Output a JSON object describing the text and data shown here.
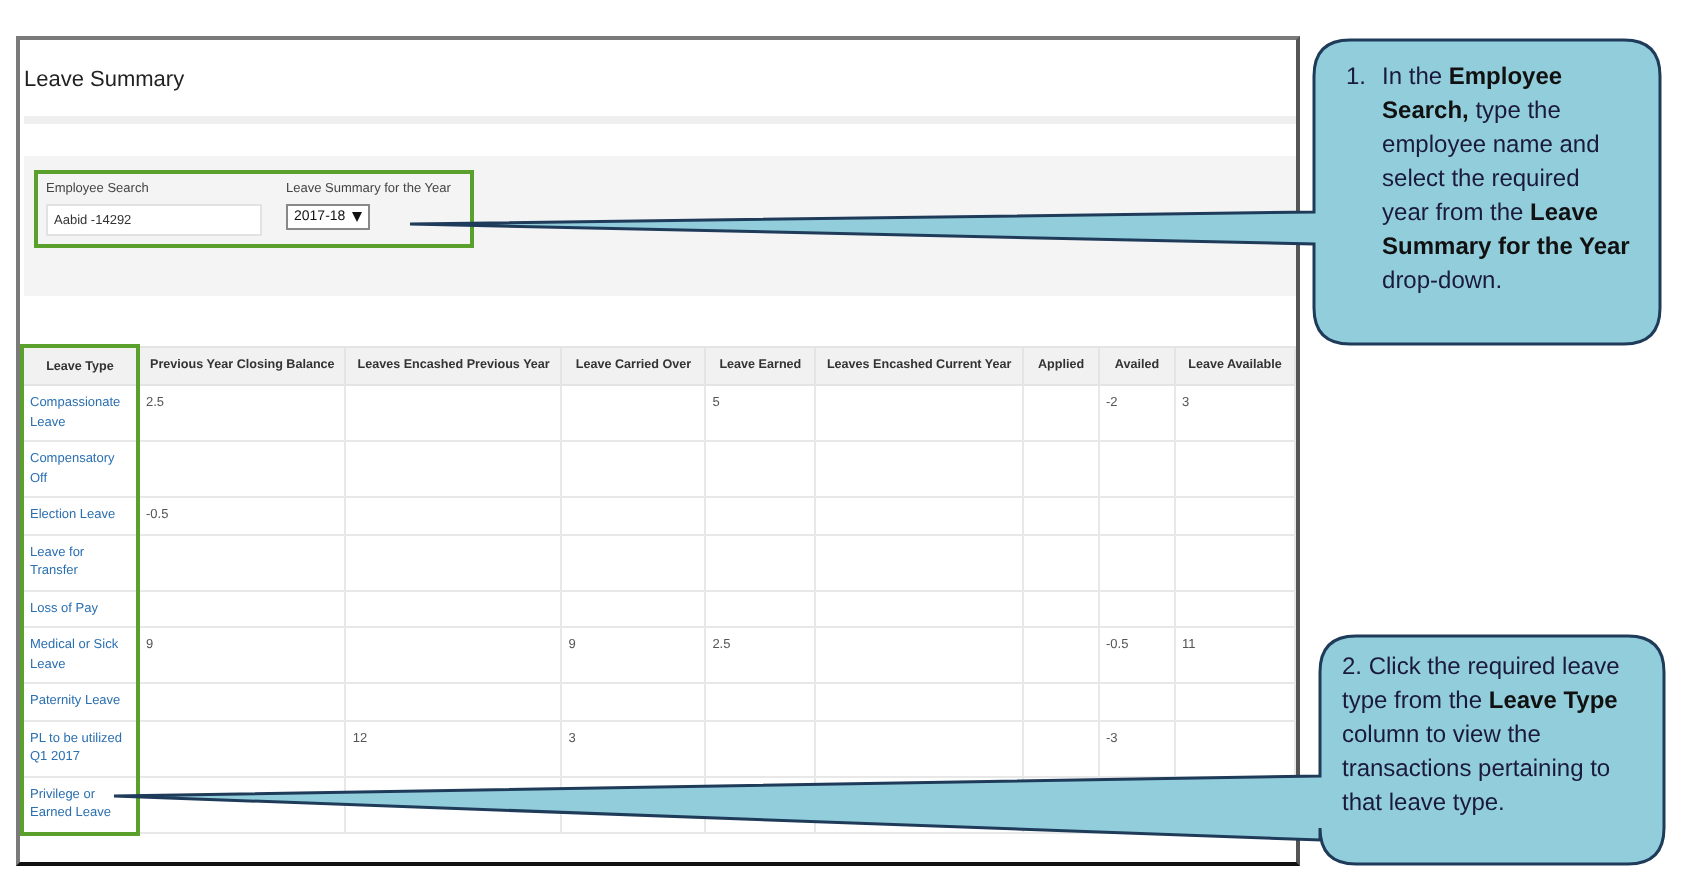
{
  "page": {
    "title": "Leave Summary"
  },
  "filters": {
    "employee_search": {
      "label": "Employee Search",
      "value": "Aabid -14292"
    },
    "year": {
      "label": "Leave Summary for the Year",
      "value": "2017-18"
    }
  },
  "table": {
    "columns": [
      "Leave Type",
      "Previous Year Closing Balance",
      "Leaves Encashed Previous Year",
      "Leave Carried Over",
      "Leave Earned",
      "Leaves Encashed Current Year",
      "Applied",
      "Availed",
      "Leave Available"
    ],
    "rows": [
      [
        "Compassionate Leave",
        "2.5",
        "",
        "",
        "5",
        "",
        "",
        "-2",
        "3"
      ],
      [
        "Compensatory Off",
        "",
        "",
        "",
        "",
        "",
        "",
        "",
        ""
      ],
      [
        "Election Leave",
        "-0.5",
        "",
        "",
        "",
        "",
        "",
        "",
        ""
      ],
      [
        "Leave for Transfer",
        "",
        "",
        "",
        "",
        "",
        "",
        "",
        ""
      ],
      [
        "Loss of Pay",
        "",
        "",
        "",
        "",
        "",
        "",
        "",
        ""
      ],
      [
        "Medical or Sick Leave",
        "9",
        "",
        "9",
        "2.5",
        "",
        "",
        "-0.5",
        "11"
      ],
      [
        "Paternity Leave",
        "",
        "",
        "",
        "",
        "",
        "",
        "",
        ""
      ],
      [
        "PL to be utilized Q1 2017",
        "",
        "12",
        "3",
        "",
        "",
        "",
        "-3",
        ""
      ],
      [
        "Privilege or Earned Leave",
        "",
        "",
        "",
        "",
        "",
        "",
        "",
        ""
      ]
    ]
  },
  "callouts": [
    {
      "marker": "1.",
      "text": "In the **Employee Search,** type the employee name and select the required year from the **Leave Summary for the Year** drop-down."
    },
    {
      "text": "2. Click the required leave type from the **Leave Type** column to view the transactions pertaining to that leave type."
    }
  ]
}
